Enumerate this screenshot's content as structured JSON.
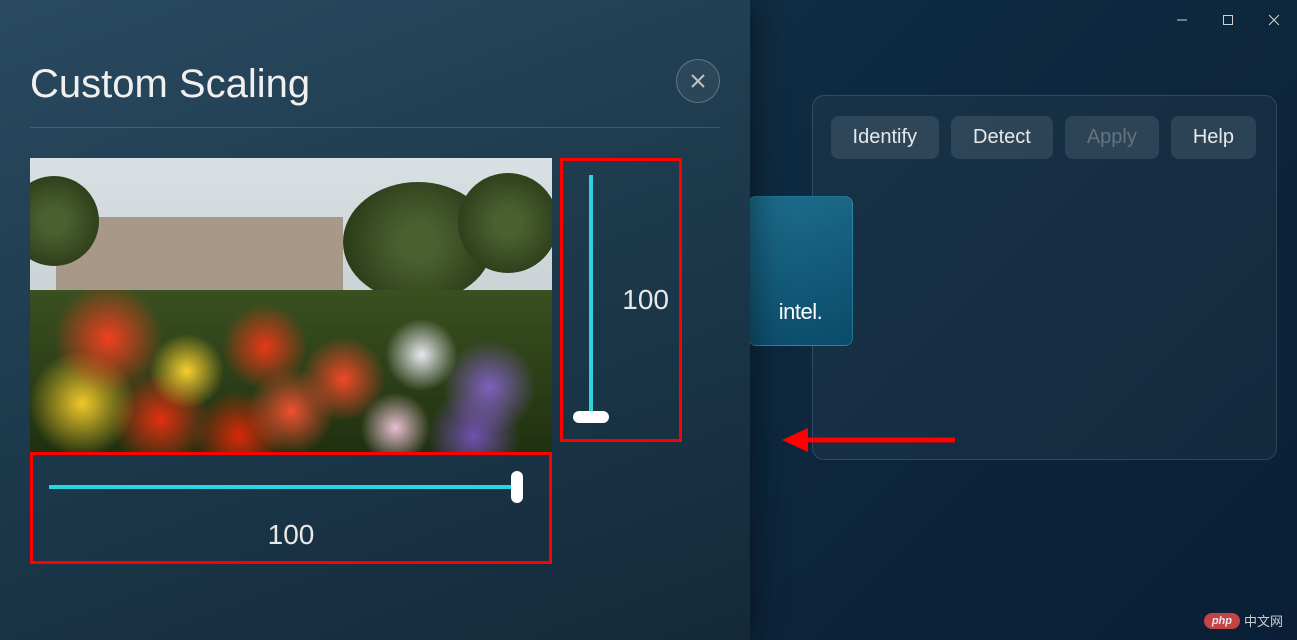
{
  "window_controls": {
    "minimize": "minimize",
    "maximize": "maximize",
    "close": "close"
  },
  "modal": {
    "title": "Custom Scaling",
    "close_label": "Close",
    "horizontal_slider": {
      "value": "100"
    },
    "vertical_slider": {
      "value": "100"
    }
  },
  "right_panel": {
    "buttons": {
      "identify": "Identify",
      "detect": "Detect",
      "apply": "Apply",
      "help": "Help"
    },
    "intel_logo_text": "intel."
  },
  "watermark": {
    "pill": "php",
    "text": "中文网"
  }
}
